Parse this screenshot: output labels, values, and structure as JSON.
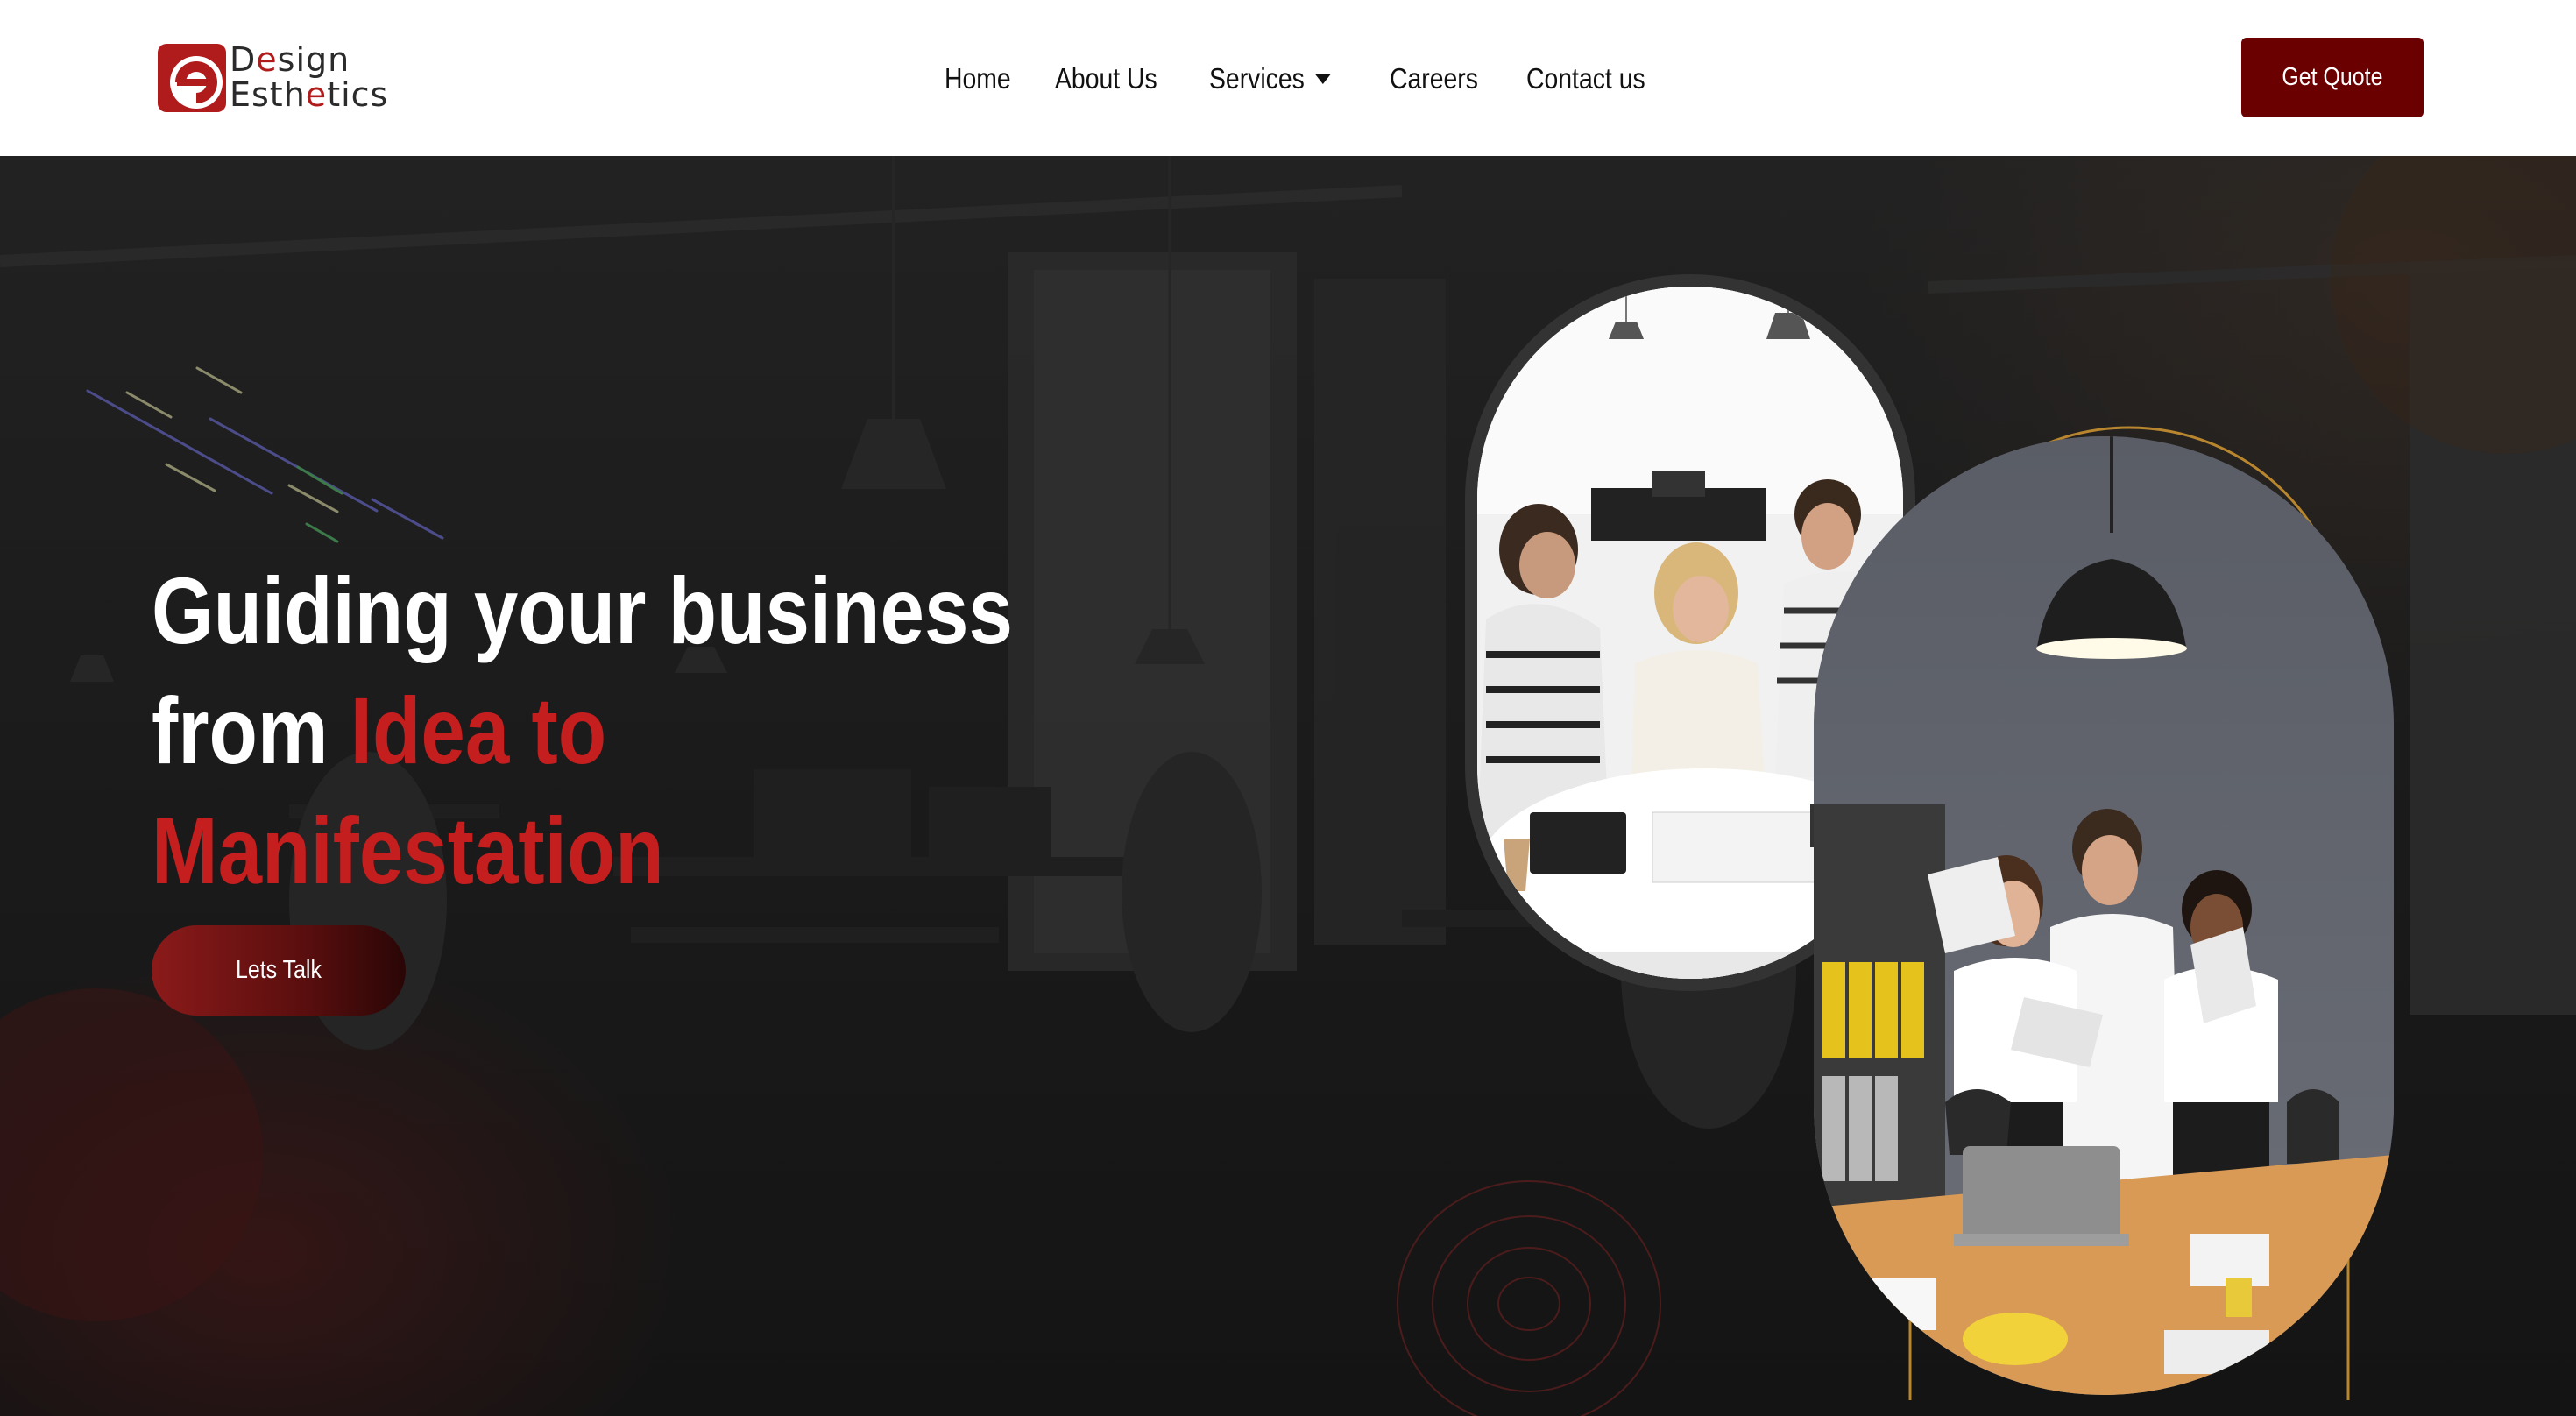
{
  "brand": {
    "line1_a": "D",
    "line1_e": "e",
    "line1_b": "sign",
    "line2_a": "Esth",
    "line2_e": "e",
    "line2_b": "tics",
    "logo_icon": "design-esthetics-logo-icon",
    "colors": {
      "primary": "#6b0000",
      "accent": "#c41e1e"
    }
  },
  "nav": {
    "items": [
      "Home",
      "About Us",
      "Services",
      "Careers",
      "Contact us"
    ],
    "services_dropdown_icon": "caret-down-icon"
  },
  "header": {
    "cta_label": "Get Quote"
  },
  "hero": {
    "title_line1": "Guiding your business",
    "title_line2_prefix": "from ",
    "title_line2_accent": "Idea to",
    "title_line3_accent": "Manifestation",
    "cta_label": "Lets Talk"
  }
}
